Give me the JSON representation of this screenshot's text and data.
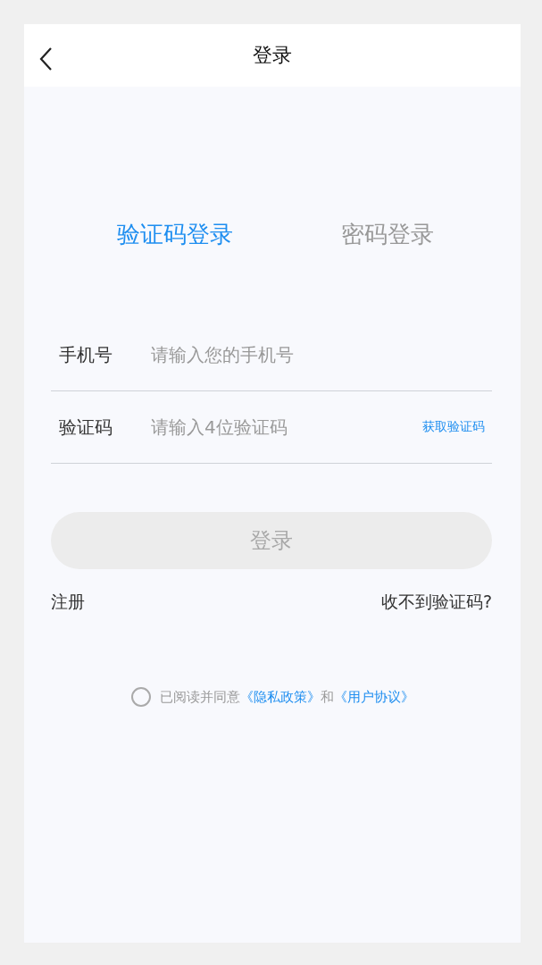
{
  "header": {
    "title": "登录"
  },
  "tabs": [
    {
      "label": "验证码登录",
      "selected": true
    },
    {
      "label": "密码登录",
      "selected": false
    }
  ],
  "fields": [
    {
      "label": "手机号",
      "placeholder": "请输入您的手机号"
    },
    {
      "label": "验证码",
      "placeholder": "请输入4位验证码",
      "action": "获取验证码"
    }
  ],
  "login_button": {
    "label": "登录",
    "disabled": true
  },
  "links": {
    "register": "注册",
    "no_code": "收不到验证码?"
  },
  "agreement": {
    "checked": false,
    "text": "已阅读并同意",
    "privacy": "《隐私政策》",
    "and": "和",
    "terms": "《用户协议》"
  }
}
